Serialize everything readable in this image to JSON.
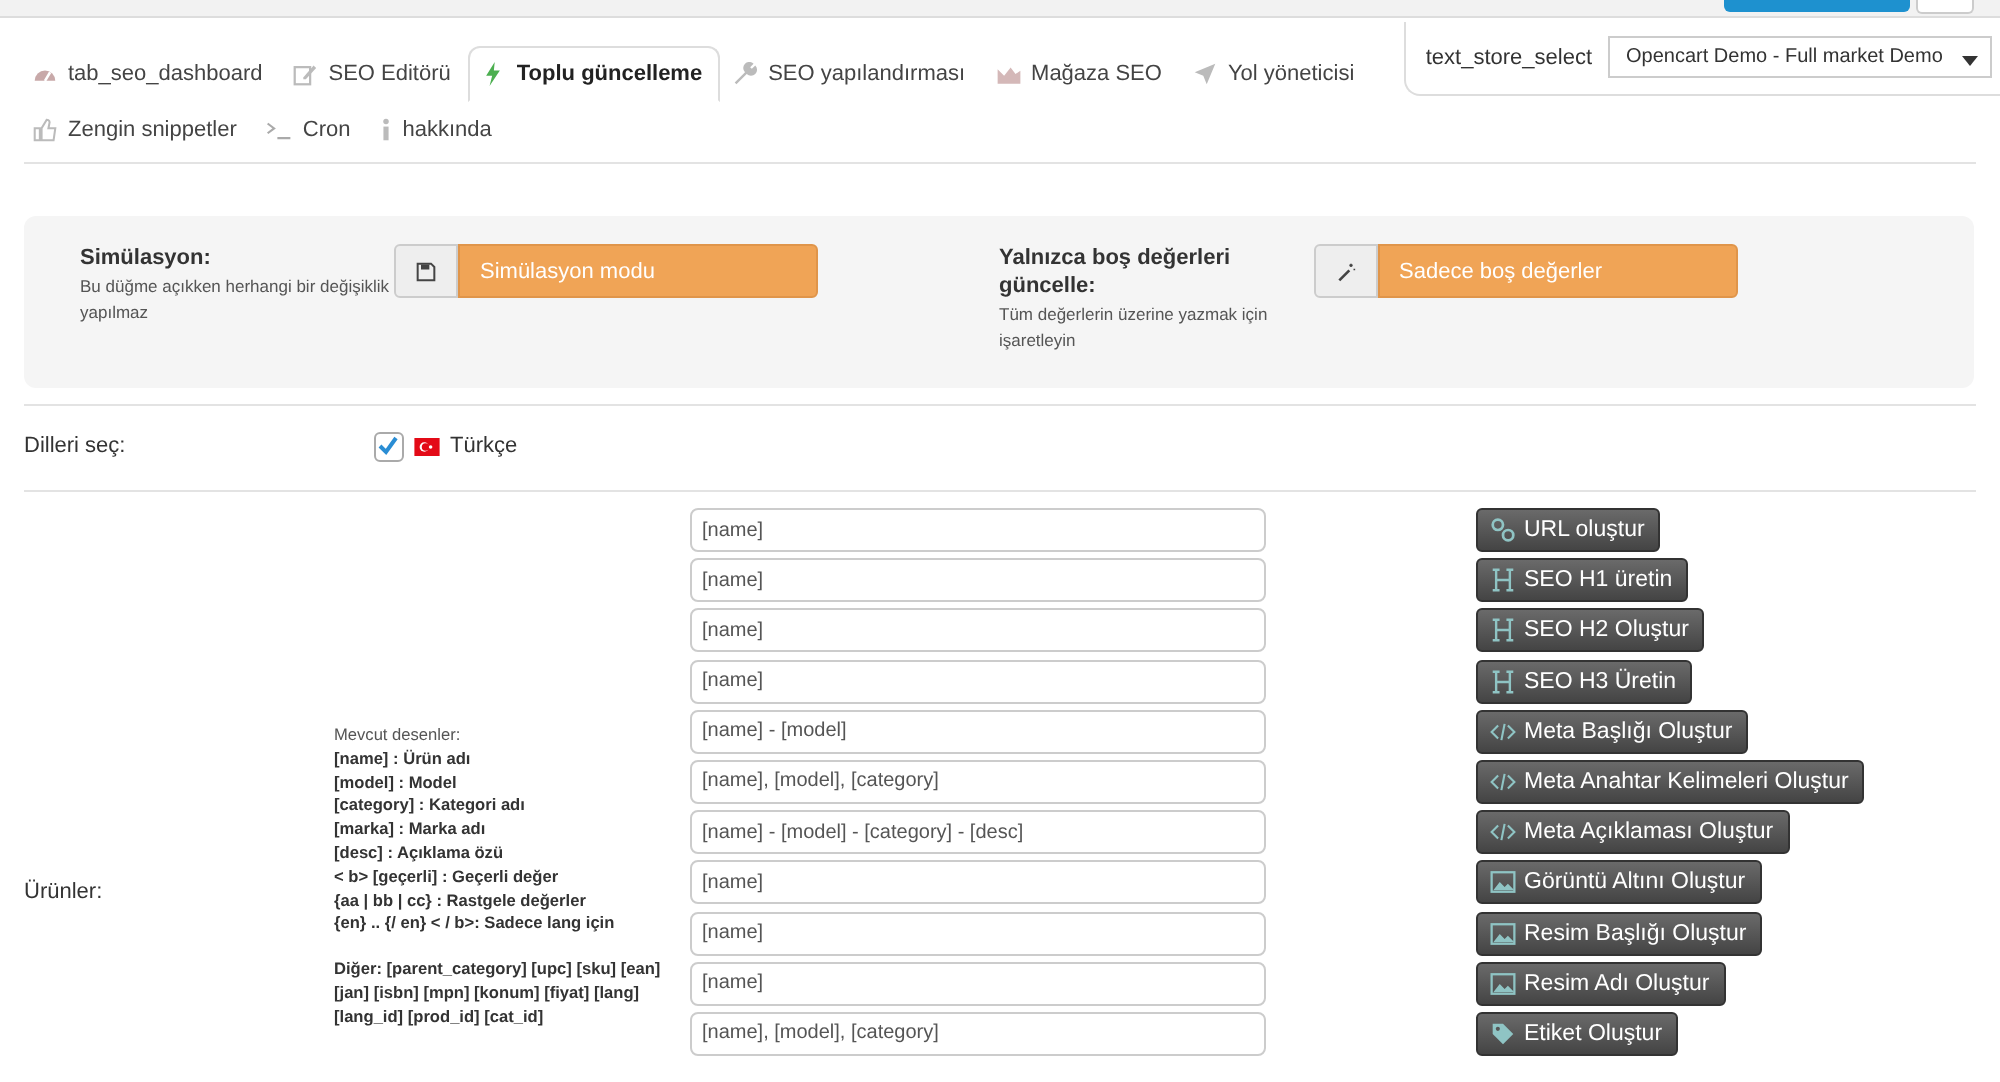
{
  "tabs": [
    {
      "label": "tab_seo_dashboard",
      "kind": "dashboard",
      "selected": false
    },
    {
      "label": "SEO Editörü",
      "kind": "edit",
      "selected": false
    },
    {
      "label": "Toplu güncelleme",
      "kind": "bolt",
      "selected": true
    },
    {
      "label": "SEO yapılandırması",
      "kind": "wrench",
      "selected": false
    },
    {
      "label": "Mağaza SEO",
      "kind": "chart",
      "selected": false
    },
    {
      "label": "Yol yöneticisi",
      "kind": "send",
      "selected": false
    },
    {
      "label": "Zengin snippetler",
      "kind": "thumb",
      "selected": false
    },
    {
      "label": "Cron",
      "kind": "terminal",
      "selected": false
    },
    {
      "label": "hakkında",
      "kind": "info",
      "selected": false
    }
  ],
  "store_select": {
    "label": "text_store_select",
    "value": "Opencart Demo - Full market Demo"
  },
  "options": [
    {
      "title": "Simülasyon:",
      "help": "Bu düğme açıkken herhangi bir değişiklik yapılmaz",
      "button": "Simülasyon modu",
      "kind": "save"
    },
    {
      "title": "Yalnızca boş değerleri güncelle:",
      "help": "Tüm değerlerin üzerine yazmak için işaretleyin",
      "button": "Sadece boş değerler",
      "kind": "wand"
    }
  ],
  "languages": {
    "label": "Dilleri seç:",
    "items": [
      {
        "name": "Türkçe",
        "checked": true
      }
    ]
  },
  "products": {
    "label": "Ürünler:",
    "patterns_title": "Mevcut desenler:",
    "patterns": [
      "[name] : Ürün adı",
      "[model] : Model",
      "[category] : Kategori adı",
      "[marka] : Marka adı",
      "[desc] : Açıklama özü",
      "< b> [geçerli] : Geçerli değer",
      "{aa | bb | cc} : Rastgele değerler",
      "{en} .. {/ en} < / b>: Sadece lang için"
    ],
    "other": "Diğer: [parent_category] [upc] [sku] [ean] [jan] [isbn] [mpn] [konum] [fiyat] [lang] [lang_id] [prod_id] [cat_id]",
    "fields": [
      "[name]",
      "[name]",
      "[name]",
      "[name]",
      "[name] - [model]",
      "[name], [model], [category]",
      "[name] - [model] - [category] - [desc]",
      "[name]",
      "[name]",
      "[name]",
      "[name], [model], [category]"
    ],
    "actions": [
      {
        "label": "URL oluştur",
        "kind": "link"
      },
      {
        "label": "SEO H1 üretin",
        "kind": "heading"
      },
      {
        "label": "SEO H2 Oluştur",
        "kind": "heading"
      },
      {
        "label": "SEO H3 Üretin",
        "kind": "heading"
      },
      {
        "label": "Meta Başlığı Oluştur",
        "kind": "code"
      },
      {
        "label": "Meta Anahtar Kelimeleri Oluştur",
        "kind": "code"
      },
      {
        "label": "Meta Açıklaması Oluştur",
        "kind": "code"
      },
      {
        "label": "Görüntü Altını Oluştur",
        "kind": "image"
      },
      {
        "label": "Resim Başlığı Oluştur",
        "kind": "image"
      },
      {
        "label": "Resim Adı Oluştur",
        "kind": "image"
      },
      {
        "label": "Etiket Oluştur",
        "kind": "tag"
      }
    ]
  }
}
